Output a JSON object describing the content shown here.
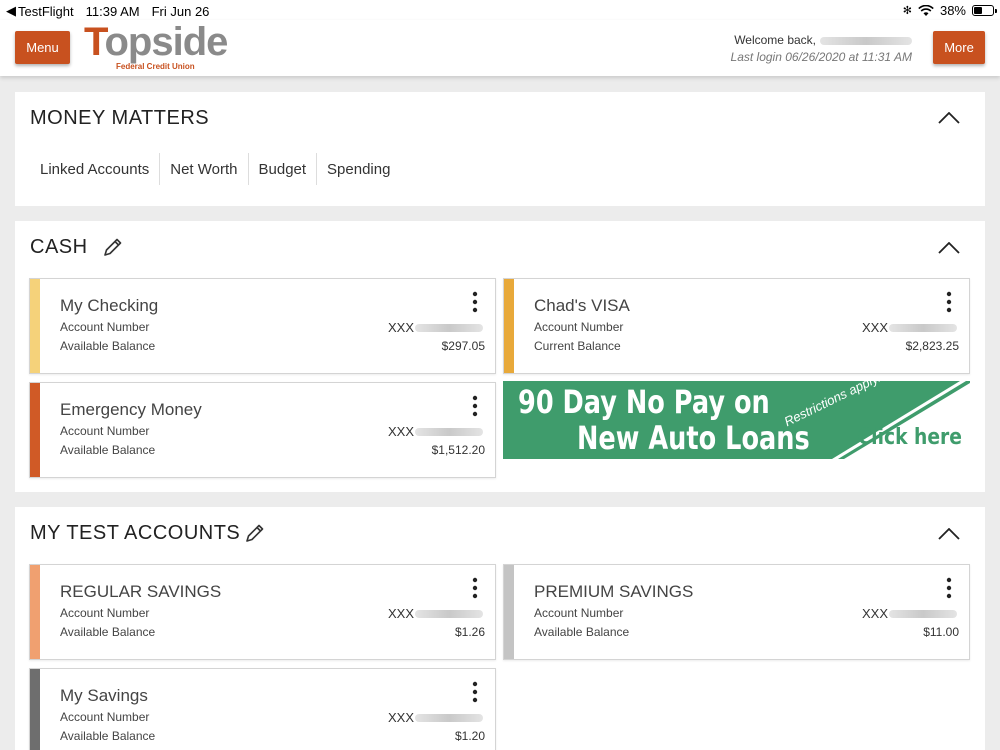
{
  "status": {
    "app": "TestFlight",
    "time": "11:39 AM",
    "date": "Fri Jun 26",
    "battery": "38%",
    "battery_level": 0.38
  },
  "header": {
    "menu_label": "Menu",
    "more_label": "More",
    "logo_word": "opside",
    "logo_letter": "T",
    "logo_sub": "Federal Credit Union",
    "welcome": "Welcome back,",
    "last_login": "Last login 06/26/2020 at 11:31 AM"
  },
  "money_matters": {
    "title": "MONEY MATTERS",
    "tabs": [
      "Linked Accounts",
      "Net Worth",
      "Budget",
      "Spending"
    ]
  },
  "cash": {
    "title": "CASH",
    "accounts": [
      {
        "name": "My Checking",
        "number_label": "Account Number",
        "number_prefix": "XXX",
        "balance_label": "Available Balance",
        "balance": "$297.05",
        "color": "#f5d27a"
      },
      {
        "name": "Chad's VISA",
        "number_label": "Account Number",
        "number_prefix": "XXX",
        "balance_label": "Current Balance",
        "balance": "$2,823.25",
        "color": "#e8a93a"
      },
      {
        "name": "Emergency Money",
        "number_label": "Account Number",
        "number_prefix": "XXX",
        "balance_label": "Available Balance",
        "balance": "$1,512.20",
        "color": "#d05a26"
      }
    ],
    "promo": {
      "line1": "90 Day No Pay on",
      "line2": "New Auto Loans",
      "restrictions": "Restrictions apply.",
      "cta": "Click here"
    }
  },
  "test_accounts": {
    "title": "MY TEST ACCOUNTS",
    "accounts": [
      {
        "name": "REGULAR SAVINGS",
        "number_label": "Account Number",
        "number_prefix": "XXX",
        "balance_label": "Available Balance",
        "balance": "$1.26",
        "color": "#f0a070"
      },
      {
        "name": "PREMIUM SAVINGS",
        "number_label": "Account Number",
        "number_prefix": "XXX",
        "balance_label": "Available Balance",
        "balance": "$11.00",
        "color": "#c4c4c4"
      },
      {
        "name": "My Savings",
        "number_label": "Account Number",
        "number_prefix": "XXX",
        "balance_label": "Available Balance",
        "balance": "$1.20",
        "color": "#6e6e6e"
      }
    ]
  }
}
